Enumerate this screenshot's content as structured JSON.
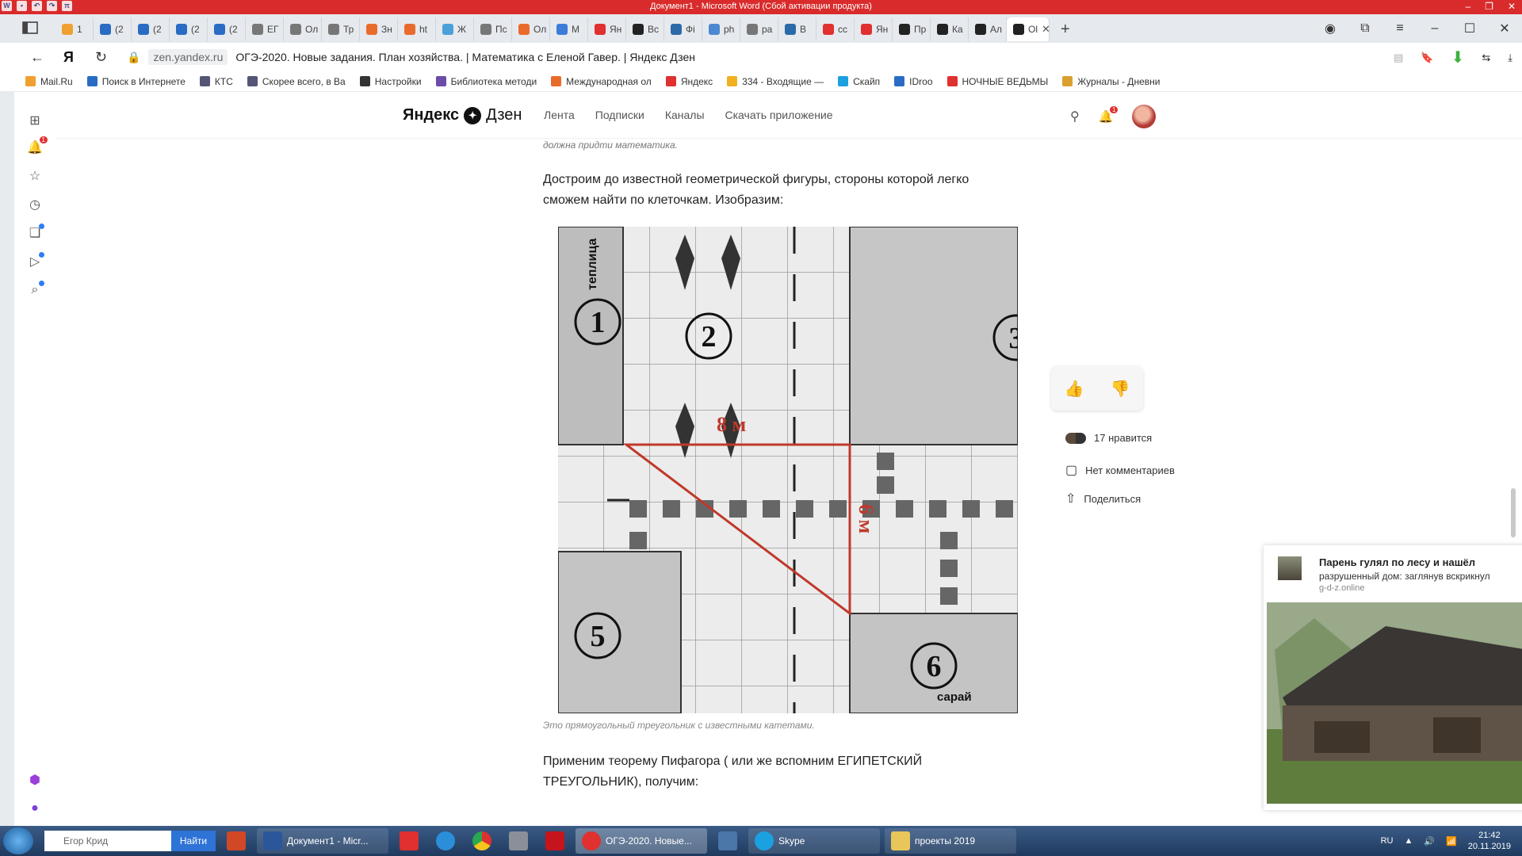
{
  "word_title": "Документ1 - Microsoft Word (Сбой активации продукта)",
  "tabs": [
    {
      "label": "1 ",
      "color": "#f0a030"
    },
    {
      "label": "(2",
      "color": "#2a6cc4"
    },
    {
      "label": "(2",
      "color": "#2a6cc4"
    },
    {
      "label": "(2",
      "color": "#2a6cc4"
    },
    {
      "label": "(2",
      "color": "#2a6cc4"
    },
    {
      "label": "ЕГ",
      "color": "#777"
    },
    {
      "label": "Ол",
      "color": "#777"
    },
    {
      "label": "Тр",
      "color": "#777"
    },
    {
      "label": "Зн",
      "color": "#e96b2b"
    },
    {
      "label": "ht",
      "color": "#e96b2b"
    },
    {
      "label": "Ж",
      "color": "#4aa0d8"
    },
    {
      "label": "Пс",
      "color": "#777"
    },
    {
      "label": "Ол",
      "color": "#e96b2b"
    },
    {
      "label": "М",
      "color": "#3b7dd8"
    },
    {
      "label": "Ян",
      "color": "#e0302f"
    },
    {
      "label": "Вс",
      "color": "#222"
    },
    {
      "label": "Фі",
      "color": "#2b6aa8"
    },
    {
      "label": "ph",
      "color": "#4a88d0"
    },
    {
      "label": "ра",
      "color": "#777"
    },
    {
      "label": "В",
      "color": "#2b6aa8"
    },
    {
      "label": "сс",
      "color": "#e0302f"
    },
    {
      "label": "Ян",
      "color": "#e0302f"
    },
    {
      "label": "Пр",
      "color": "#222"
    },
    {
      "label": "Ка",
      "color": "#222"
    },
    {
      "label": "Ал",
      "color": "#222"
    },
    {
      "label": "Ol",
      "color": "#222"
    }
  ],
  "address": {
    "domain": "zen.yandex.ru",
    "title": "ОГЭ-2020. Новые задания. План хозяйства. | Математика с Еленой Гавер. | Яндекс Дзен"
  },
  "bookmarks": [
    {
      "label": "Mail.Ru",
      "color": "#f0a030"
    },
    {
      "label": "Поиск в Интернете",
      "color": "#2a6cc4"
    },
    {
      "label": "КТС",
      "color": "#557"
    },
    {
      "label": "Скорее всего, в Ва",
      "color": "#557"
    },
    {
      "label": "Настройки",
      "color": "#333"
    },
    {
      "label": "Библиотека методи",
      "color": "#6b4ca8"
    },
    {
      "label": "Международная ол",
      "color": "#e96b2b"
    },
    {
      "label": "Яндекс",
      "color": "#e0302f"
    },
    {
      "label": "334 - Входящие — ",
      "color": "#f0b020"
    },
    {
      "label": "Скайп",
      "color": "#1ba0e0"
    },
    {
      "label": "IDroo",
      "color": "#2a6cc4"
    },
    {
      "label": "НОЧНЫЕ ВЕДЬМЫ",
      "color": "#e0302f"
    },
    {
      "label": "Журналы - Дневни",
      "color": "#d9a030"
    }
  ],
  "zen": {
    "logo": "Яндекс",
    "logo2": "Дзен",
    "nav": [
      "Лента",
      "Подписки",
      "Каналы",
      "Скачать приложение"
    ],
    "notifications": "1"
  },
  "article": {
    "prev_line": "должна придти математика.",
    "para1": "Достроим до известной геометрической фигуры, стороны которой легко сможем найти по клеточкам. Изобразим:",
    "caption": "Это прямоугольный треугольник с известными катетами.",
    "para2": "Применим теорему Пифагора ( или же вспомним ЕГИПЕТСКИЙ ТРЕУГОЛЬНИК), получим:"
  },
  "figure": {
    "label_teplitsa": "теплица",
    "label_saray": "сарай",
    "num1": "1",
    "num2": "2",
    "num3": "3",
    "num5": "5",
    "num6": "6",
    "leg_top": "8 м",
    "leg_side": "6 м",
    "accent": "#c0392b"
  },
  "reactions": {
    "likes": "17 нравится",
    "comments": "Нет комментариев",
    "share": "Поделиться"
  },
  "ad": {
    "title": "Парень гулял по лесу и нашёл",
    "sub": "разрушенный дом: заглянув вскрикнул",
    "source": "g-d-z.online"
  },
  "taskbar": {
    "search_value": "Егор Крид",
    "find": "Найти",
    "items": [
      {
        "label": "Документ1 - Micr...",
        "color": "#2b579a"
      },
      {
        "label": "ОГЭ-2020. Новые...",
        "color": "#e0302f"
      },
      {
        "label": "Skype",
        "color": "#1ba0e0"
      },
      {
        "label": "проекты 2019",
        "color": "#e8c65a"
      }
    ],
    "lang": "RU",
    "time": "21:42",
    "date": "20.11.2019"
  }
}
